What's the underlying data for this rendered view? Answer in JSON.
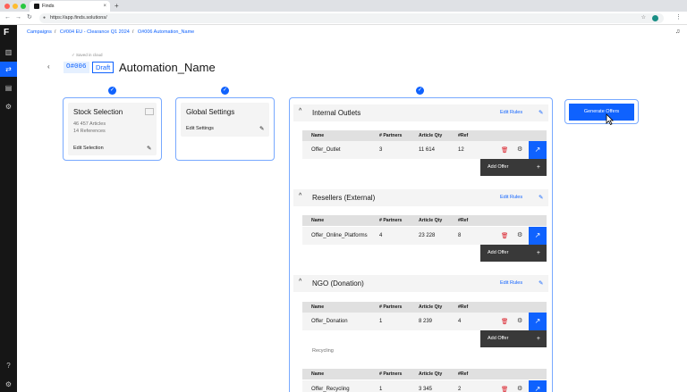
{
  "browser": {
    "tab_title": "Finds",
    "new_tab": "+",
    "url": "https://app.finds.solutions/",
    "profile_initial": ""
  },
  "breadcrumb": [
    "Campaigns",
    "C#004 EU - Clearance Q1 2024",
    "O#006 Automation_Name"
  ],
  "header": {
    "saved_status": "Saved in cloud",
    "id_chip": "O#006",
    "status_chip": "Draft",
    "title": "Automation_Name"
  },
  "stock_selection": {
    "title": "Stock Selection",
    "articles": "46 457  Articles",
    "references": "14  References",
    "edit_label": "Edit Selection"
  },
  "global_settings": {
    "title": "Global Settings",
    "edit_label": "Edit Settings"
  },
  "generate_button": "Generate Offers",
  "table_headers": {
    "name": "Name",
    "partners": "# Partners",
    "qty": "Article Qty",
    "ref": "#Ref"
  },
  "add_offer_label": "Add Offer",
  "edit_rules_label": "Edit Rules",
  "stray_text": "Recycling",
  "sections": [
    {
      "title": "Internal Outlets",
      "row": {
        "name": "Offer_Outlet",
        "partners": "3",
        "qty": "11 614",
        "ref": "12"
      }
    },
    {
      "title": "Resellers (External)",
      "row": {
        "name": "Offer_Online_Platforms",
        "partners": "4",
        "qty": "23 228",
        "ref": "8"
      }
    },
    {
      "title": "NGO (Donation)",
      "row": {
        "name": "Offer_Donation",
        "partners": "1",
        "qty": "8 239",
        "ref": "4"
      }
    },
    {
      "title": "",
      "row": {
        "name": "Offer_Recycling",
        "partners": "1",
        "qty": "3 345",
        "ref": "2"
      }
    }
  ],
  "colors": {
    "accent": "#0f62fe",
    "sidebar": "#161616",
    "danger": "#da1e28"
  },
  "icons": [
    "back-arrow-icon",
    "forward-arrow-icon",
    "reload-icon",
    "lock-icon",
    "star-icon",
    "bell-icon",
    "chart-icon",
    "transfer-icon",
    "folder-icon",
    "settings-icon",
    "help-icon",
    "gear-icon",
    "checkmark-icon",
    "pencil-icon",
    "trash-icon",
    "open-external-icon",
    "chevron-up-icon",
    "plus-icon",
    "cursor-icon"
  ]
}
